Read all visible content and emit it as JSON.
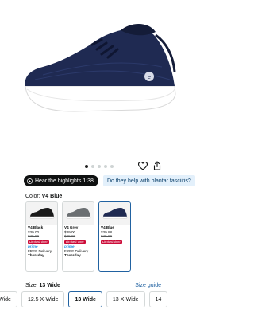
{
  "product": {
    "image_alt": "navy knit sneaker",
    "image_count": 5,
    "active_image": 0
  },
  "actions": {
    "favorite_icon": "heart-outline-icon",
    "share_icon": "share-icon"
  },
  "highlights": {
    "play_label": "Hear the highlights 1:38",
    "question_label": "Do they help with plantar fasciitis?"
  },
  "color": {
    "label": "Color:",
    "selected": "V4 Blue",
    "variants": [
      {
        "name": "V4 Black",
        "price": "$39.00",
        "was": "$45.89",
        "deal": "Limited time",
        "prime": "prime",
        "delivery": "FREE Delivery",
        "day": "Thursday",
        "shoe_color": "#1b1b1b"
      },
      {
        "name": "V4 Grey",
        "price": "$39.00",
        "was": "$45.89",
        "deal": "Limited time",
        "prime": "prime",
        "delivery": "FREE Delivery",
        "day": "Thursday",
        "shoe_color": "#6b6f72"
      },
      {
        "name": "V4 Blue",
        "price": "$39.88",
        "was": "$45.89",
        "deal": "Limited time",
        "prime": "",
        "delivery": "",
        "day": "",
        "shoe_color": "#1f2a52"
      }
    ]
  },
  "size": {
    "label": "Size:",
    "selected": "13 Wide",
    "guide": "Size guide",
    "options": [
      "Wide",
      "12.5 X-Wide",
      "13 Wide",
      "13 X-Wide",
      "14"
    ]
  },
  "colors": {
    "accent": "#2162a1",
    "deal": "#cc0c39",
    "shoe_navy": "#1f2a52"
  }
}
